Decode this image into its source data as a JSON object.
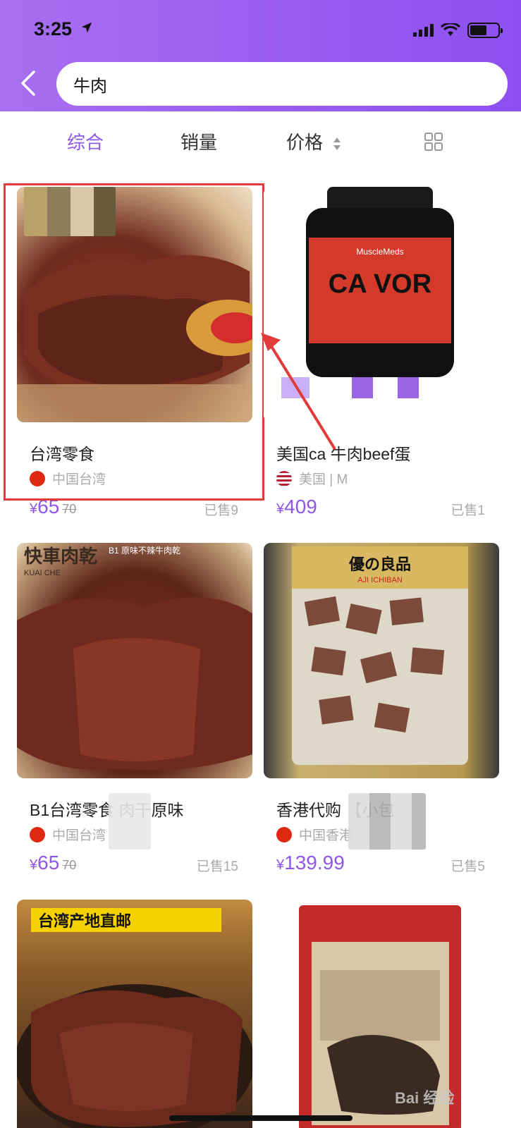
{
  "status": {
    "time": "3:25"
  },
  "search": {
    "query": "牛肉"
  },
  "sort": {
    "items": [
      "综合",
      "销量",
      "价格"
    ],
    "active": "综合"
  },
  "colors": {
    "accent": "#8e57e8",
    "header_start": "#a86ff0",
    "annotation": "#e23b3b"
  },
  "products": [
    {
      "title": "台湾零食",
      "origin": "中国台湾",
      "price": "65",
      "original_price": "70",
      "sold": "已售9",
      "flag": "china-flag-icon"
    },
    {
      "title": "美国ca     牛肉beef蛋",
      "origin": "美国 | M",
      "price": "409",
      "original_price": "",
      "sold": "已售1",
      "flag": "usa-flag-icon"
    },
    {
      "title": "B1台湾零食          肉干原味",
      "origin": "中国台湾",
      "price": "65",
      "original_price": "70",
      "sold": "已售15",
      "flag": "china-flag-icon"
    },
    {
      "title": "香港代购             【小包",
      "origin": "中国香港",
      "price": "139.99",
      "original_price": "",
      "sold": "已售5",
      "flag": "china-flag-icon"
    }
  ],
  "image_text": {
    "p3_brand": "快車肉乾",
    "p3_brand_sub": "KUAI CHE",
    "p3_banner": "B1 原味不辣牛肉乾",
    "p4_brand": "優の良品",
    "p4_brand_sub": "AJI ICHIBAN",
    "p5_banner": "台湾产地直邮",
    "p2_brand": "MuscleMeds",
    "p2_brand_large": "CA    VOR"
  },
  "watermark": "Bai 经验"
}
